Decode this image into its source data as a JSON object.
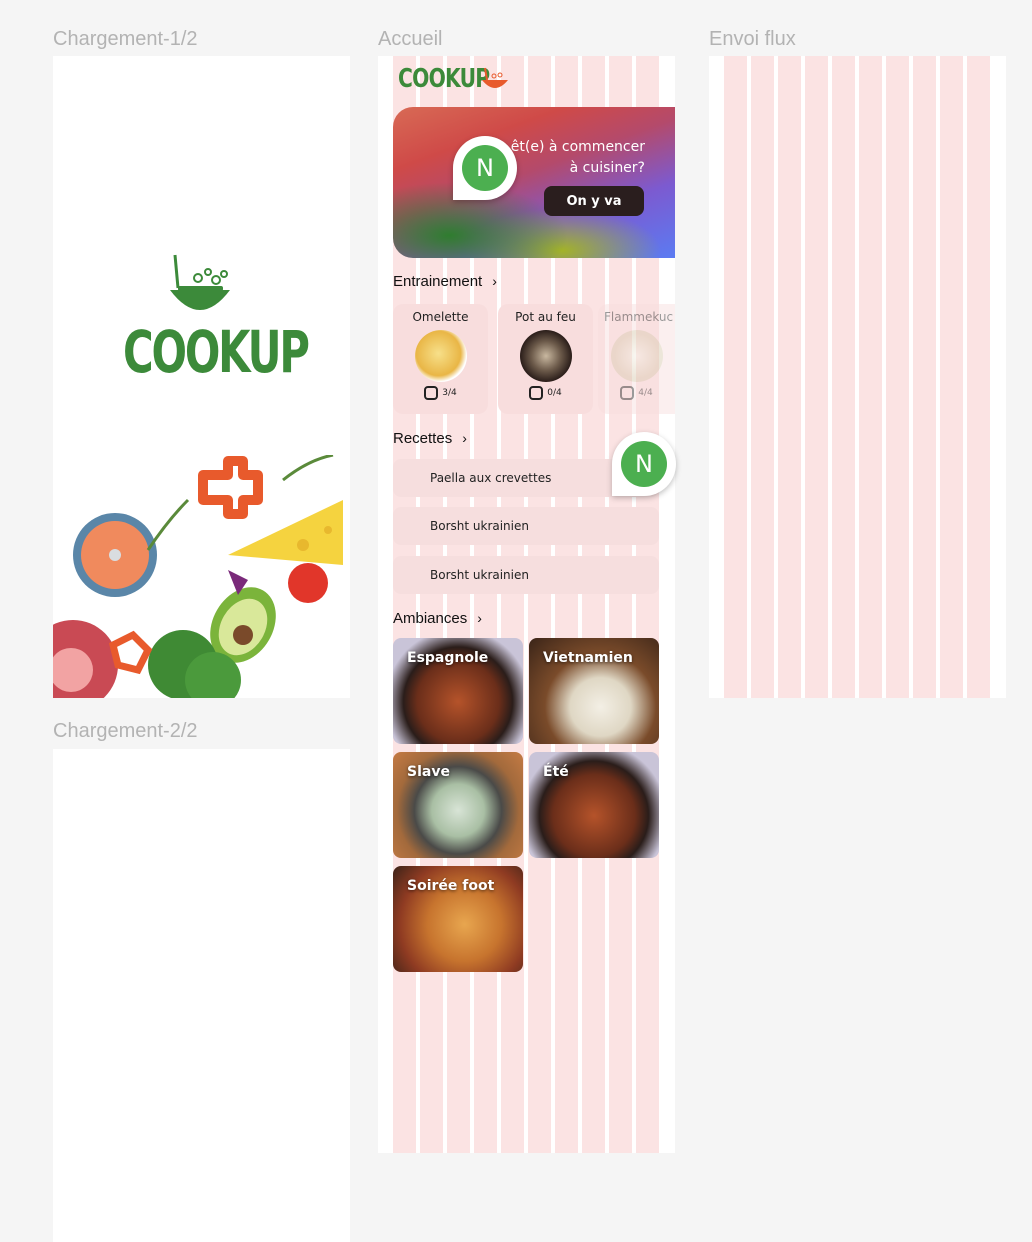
{
  "frames": {
    "loading1_label": "Chargement-1/2",
    "loading2_label": "Chargement-2/2",
    "home_label": "Accueil",
    "feed_label": "Envoi flux"
  },
  "brand": {
    "name": "COOKUP",
    "green": "#3c8a3a",
    "accent": "#4caf50"
  },
  "hero": {
    "text_line1": "êt(e) à commencer",
    "text_line2": "à cuisiner?",
    "button": "On y va"
  },
  "avatar": {
    "initial": "N"
  },
  "sections": {
    "training": "Entrainement",
    "recipes": "Recettes",
    "ambiances": "Ambiances",
    "chevron": "›"
  },
  "training_cards": [
    {
      "title": "Omelette",
      "progress": "3/4"
    },
    {
      "title": "Pot au feu",
      "progress": "0/4"
    },
    {
      "title": "Flammekuc",
      "progress": "4/4"
    }
  ],
  "recipes": [
    "Paella aux crevettes",
    "Borsht ukrainien",
    "Borsht ukrainien"
  ],
  "ambiances": [
    "Espagnole",
    "Vietnamien",
    "Slave",
    "Été",
    "Soirée foot"
  ]
}
